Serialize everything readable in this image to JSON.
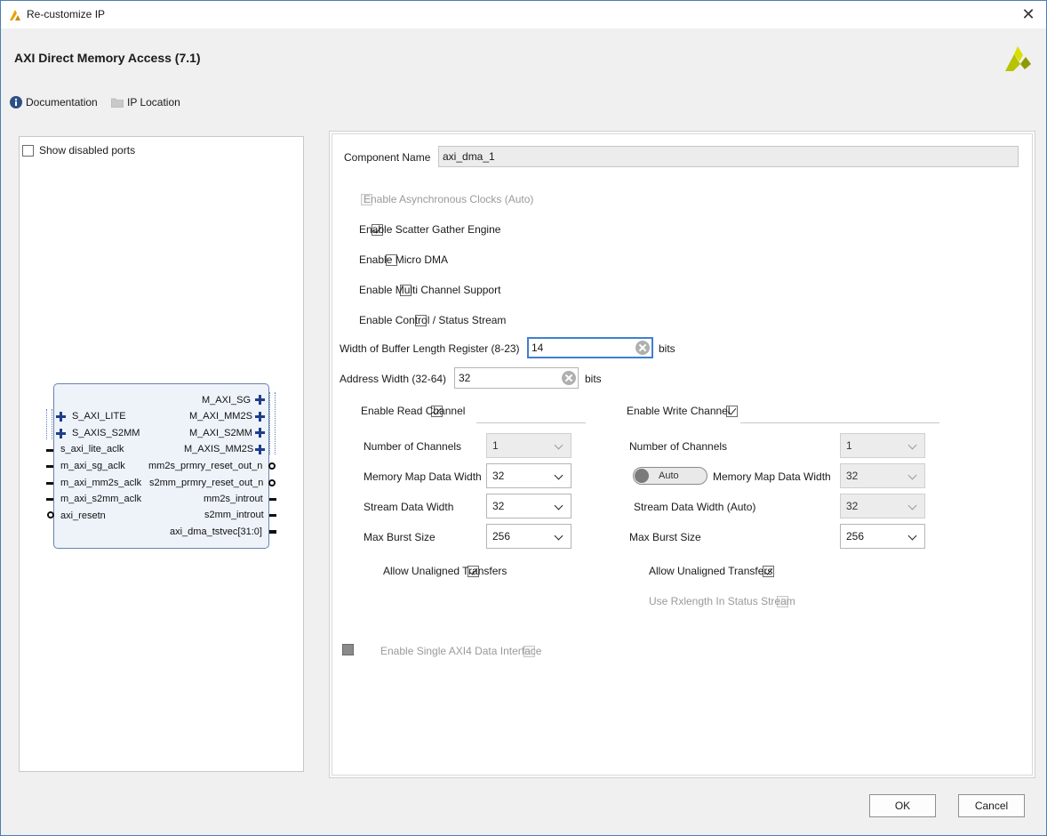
{
  "window": {
    "title": "Re-customize IP",
    "close_glyph": "✕"
  },
  "header": {
    "title": "AXI Direct Memory Access (7.1)",
    "logo_icon": "xilinx-logo-icon"
  },
  "links": {
    "documentation": "Documentation",
    "ip_location": "IP Location"
  },
  "left_panel": {
    "show_disabled_ports": "Show disabled ports",
    "block": {
      "left_ports": [
        "S_AXI_LITE",
        "S_AXIS_S2MM",
        "s_axi_lite_aclk",
        "m_axi_sg_aclk",
        "m_axi_mm2s_aclk",
        "m_axi_s2mm_aclk",
        "axi_resetn"
      ],
      "right_ports": [
        "M_AXI_SG",
        "M_AXI_MM2S",
        "M_AXI_S2MM",
        "M_AXIS_MM2S",
        "mm2s_prmry_reset_out_n",
        "s2mm_prmry_reset_out_n",
        "mm2s_introut",
        "s2mm_introut",
        "axi_dma_tstvec[31:0]"
      ]
    }
  },
  "config": {
    "component_name_label": "Component Name",
    "component_name_value": "axi_dma_1",
    "async_clocks": "Enable Asynchronous Clocks (Auto)",
    "scatter_gather": "Enable Scatter Gather Engine",
    "micro_dma": "Enable Micro DMA",
    "multi_channel": "Enable Multi Channel Support",
    "control_status": "Enable Control / Status Stream",
    "buffer_length_label": "Width of Buffer Length Register (8-23)",
    "buffer_length_value": "14",
    "buffer_length_unit": "bits",
    "address_width_label": "Address Width (32-64)",
    "address_width_value": "32",
    "address_width_unit": "bits"
  },
  "read_channel": {
    "title": "Enable Read Channel",
    "num_channels_label": "Number of Channels",
    "num_channels_value": "1",
    "mm_data_width_label": "Memory Map Data Width",
    "mm_data_width_value": "32",
    "stream_data_width_label": "Stream Data Width",
    "stream_data_width_value": "32",
    "max_burst_label": "Max Burst Size",
    "max_burst_value": "256",
    "unaligned": "Allow Unaligned Transfers"
  },
  "write_channel": {
    "title": "Enable Write Channel",
    "num_channels_label": "Number of Channels",
    "num_channels_value": "1",
    "auto_toggle": "Auto",
    "mm_data_width_label": "Memory Map Data Width",
    "mm_data_width_value": "32",
    "stream_data_width_label": "Stream Data Width (Auto)",
    "stream_data_width_value": "32",
    "max_burst_label": "Max Burst Size",
    "max_burst_value": "256",
    "unaligned": "Allow Unaligned Transfers",
    "rxlength": "Use Rxlength In Status Stream"
  },
  "single_axi4": "Enable Single AXI4 Data Interface",
  "buttons": {
    "ok": "OK",
    "cancel": "Cancel"
  },
  "colors": {
    "accent": "#3f7fd1",
    "block_fill": "#eef3fa",
    "block_border": "#6684ac",
    "plus": "#1e3e8a"
  }
}
